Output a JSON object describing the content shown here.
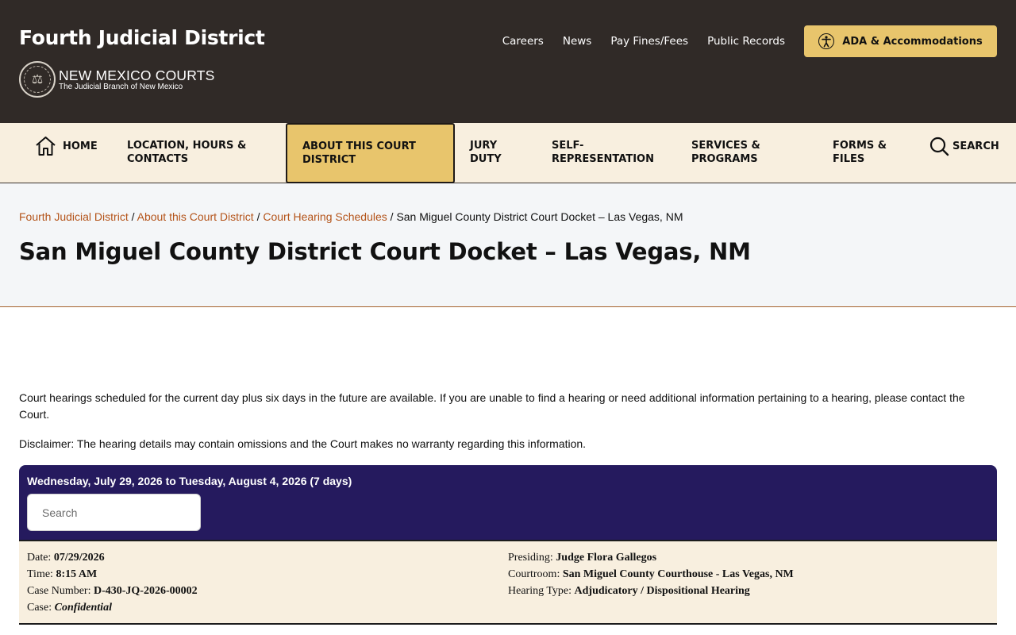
{
  "header": {
    "site_title": "Fourth Judicial District",
    "logo_main": "NEW MEXICO COURTS",
    "logo_sub": "The Judicial Branch of New Mexico",
    "utility_links": [
      "Careers",
      "News",
      "Pay Fines/Fees",
      "Public Records"
    ],
    "ada_label": "ADA & Accommodations"
  },
  "nav": {
    "home": "HOME",
    "location": [
      "LOCATION, HOURS &",
      "CONTACTS"
    ],
    "about": [
      "ABOUT THIS COURT",
      "DISTRICT"
    ],
    "jury": [
      "JURY",
      "DUTY"
    ],
    "self_rep": [
      "SELF-",
      "REPRESENTATION"
    ],
    "services": [
      "SERVICES &",
      "PROGRAMS"
    ],
    "forms": [
      "FORMS &",
      "FILES"
    ],
    "search": "SEARCH"
  },
  "breadcrumb": {
    "items": [
      "Fourth Judicial District",
      "About this Court District",
      "Court Hearing Schedules"
    ],
    "separator": "/",
    "current": "San Miguel County District Court Docket – Las Vegas, NM"
  },
  "page_title": "San Miguel County District Court Docket – Las Vegas, NM",
  "content": {
    "intro": "Court hearings scheduled for the current day plus six days in the future are available. If you are unable to find a hearing or need additional information pertaining to a hearing, please contact the Court.",
    "disclaimer": "Disclaimer:  The hearing details may contain omissions and the Court makes no warranty regarding this information."
  },
  "docket": {
    "range": "Wednesday, July 29, 2026 to Tuesday, August 4, 2026 (7 days)",
    "search_placeholder": "Search",
    "record": {
      "date_label": "Date:",
      "date": "07/29/2026",
      "time_label": "Time:",
      "time": "8:15 AM",
      "case_number_label": "Case Number:",
      "case_number": "D-430-JQ-2026-00002",
      "case_label": "Case:",
      "case": "Confidential",
      "presiding_label": "Presiding:",
      "presiding": "Judge Flora Gallegos",
      "courtroom_label": "Courtroom:",
      "courtroom": "San Miguel County Courthouse - Las Vegas, NM",
      "hearing_type_label": "Hearing Type:",
      "hearing_type": "Adjudicatory / Dispositional Hearing"
    }
  },
  "colors": {
    "header_bg": "#302a27",
    "accent_gold": "#e8c56c",
    "nav_bg": "#f8efdf",
    "link": "#b4541a",
    "docket_header": "#251a5e"
  }
}
